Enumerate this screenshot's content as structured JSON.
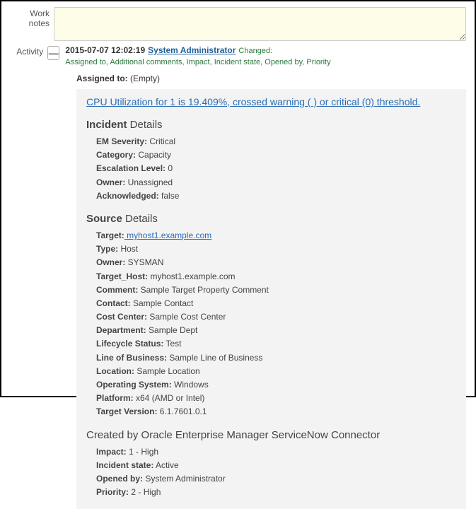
{
  "labels": {
    "work_notes": "Work notes",
    "activity": "Activity"
  },
  "work_notes_value": "",
  "toggle": "—",
  "activity_header": {
    "timestamp": "2015-07-07 12:02:19",
    "user": "System Administrator",
    "changed_label": "Changed:",
    "changed_fields": "Assigned to, Additional comments, Impact, Incident state, Opened by, Priority"
  },
  "assigned_to": {
    "label": "Assigned to:",
    "value": "(Empty)"
  },
  "headline": "CPU Utilization for 1 is 19.409%, crossed warning ( ) or critical (0) threshold.",
  "incident_title_bold": "Incident",
  "incident_title_rest": " Details",
  "incident_fields": [
    {
      "name": "EM Severity:",
      "value": " Critical"
    },
    {
      "name": "Category:",
      "value": " Capacity"
    },
    {
      "name": "Escalation Level:",
      "value": " 0"
    },
    {
      "name": "Owner:",
      "value": " Unassigned"
    },
    {
      "name": "Acknowledged:",
      "value": " false"
    }
  ],
  "source_title_bold": "Source",
  "source_title_rest": " Details",
  "source_fields": [
    {
      "name": "Target:",
      "value": " myhost1.example.com",
      "link": true
    },
    {
      "name": "Type:",
      "value": " Host"
    },
    {
      "name": "Owner:",
      "value": " SYSMAN"
    },
    {
      "name": "Target_Host:",
      "value": " myhost1.example.com"
    },
    {
      "name": "Comment:",
      "value": " Sample Target Property Comment"
    },
    {
      "name": "Contact:",
      "value": " Sample Contact"
    },
    {
      "name": "Cost Center:",
      "value": " Sample Cost Center"
    },
    {
      "name": "Department:",
      "value": " Sample Dept"
    },
    {
      "name": "Lifecycle Status:",
      "value": " Test"
    },
    {
      "name": "Line of Business:",
      "value": " Sample Line of Business"
    },
    {
      "name": "Location:",
      "value": " Sample Location"
    },
    {
      "name": "Operating System:",
      "value": " Windows"
    },
    {
      "name": "Platform:",
      "value": " x64 (AMD or Intel)"
    },
    {
      "name": "Target Version:",
      "value": " 6.1.7601.0.1"
    }
  ],
  "created_by_title": "Created by Oracle Enterprise Manager ServiceNow Connector",
  "status_fields": [
    {
      "name": "Impact:",
      "value": " 1 - High"
    },
    {
      "name": "Incident state:",
      "value": " Active"
    },
    {
      "name": "Opened by:",
      "value": " System Administrator"
    },
    {
      "name": "Priority:",
      "value": " 2 - High"
    }
  ]
}
